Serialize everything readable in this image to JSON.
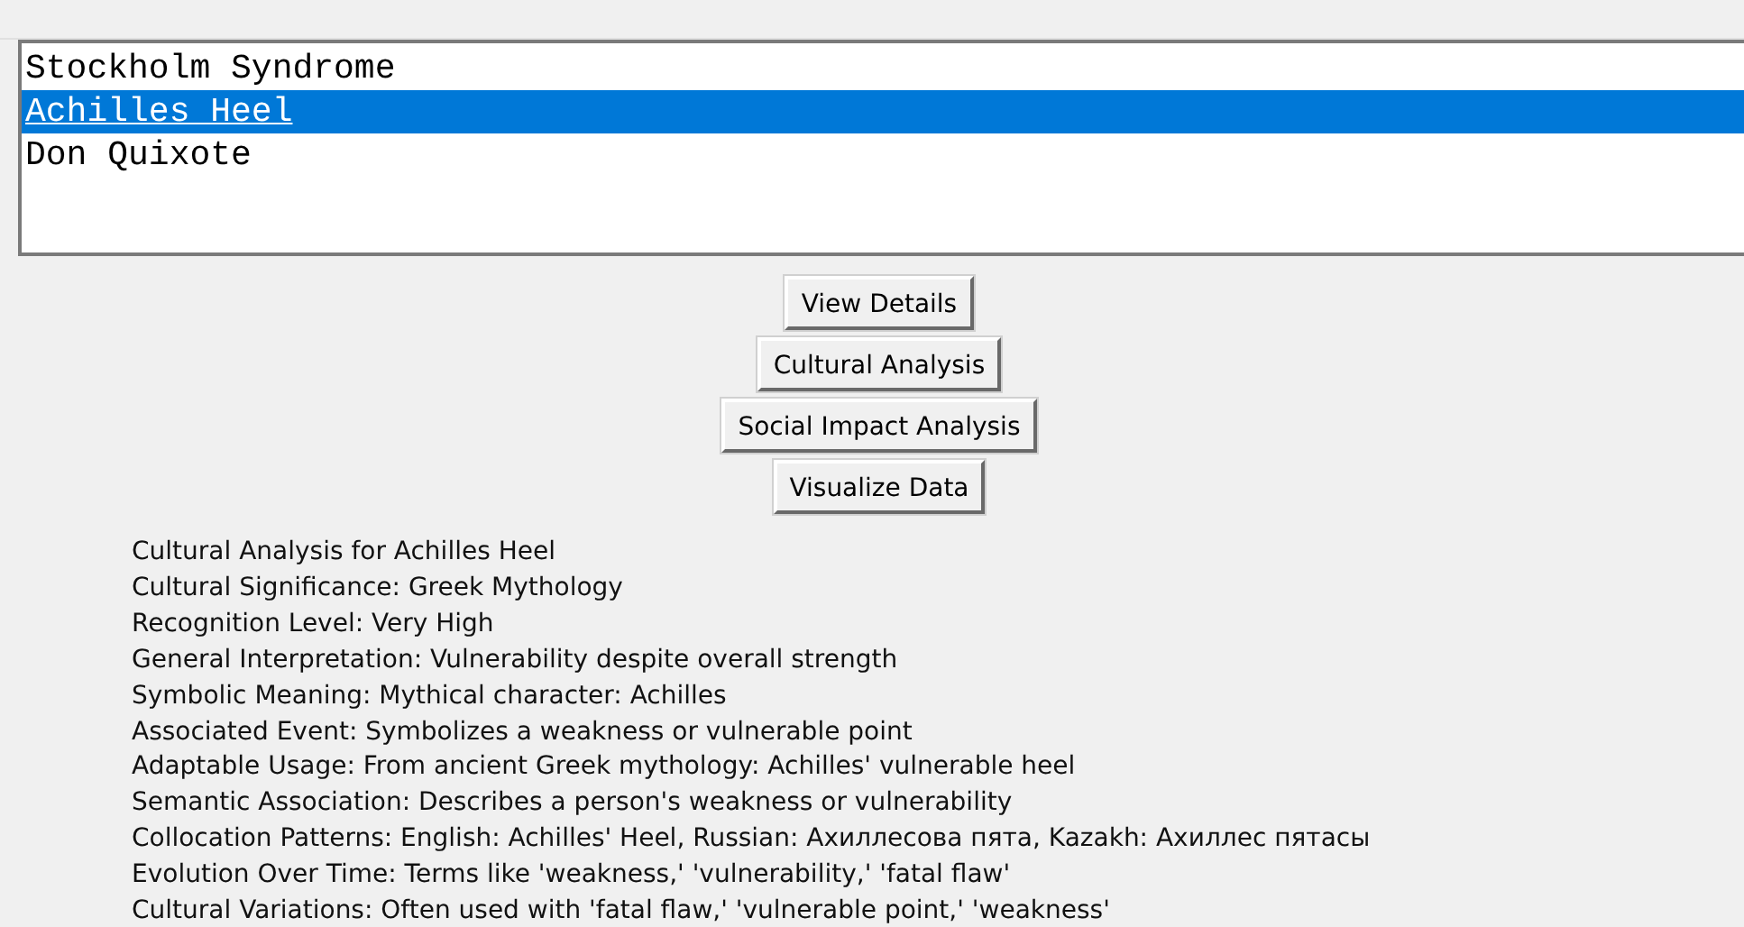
{
  "list": {
    "items": [
      {
        "label": "Stockholm Syndrome",
        "selected": false
      },
      {
        "label": "Achilles Heel",
        "selected": true
      },
      {
        "label": "Don Quixote",
        "selected": false
      }
    ]
  },
  "buttons": [
    "View Details",
    "Cultural Analysis",
    "Social Impact Analysis",
    "Visualize Data"
  ],
  "output_lines": [
    "Cultural Analysis for Achilles Heel",
    "Cultural Significance: Greek Mythology",
    "Recognition Level: Very High",
    "General Interpretation: Vulnerability despite overall strength",
    "Symbolic Meaning: Mythical character: Achilles",
    "Associated Event: Symbolizes a weakness or vulnerable point",
    "Adaptable Usage: From ancient Greek mythology: Achilles' vulnerable heel",
    "Semantic Association: Describes a person's weakness or vulnerability",
    "Collocation Patterns: English: Achilles' Heel, Russian: Ахиллесова пята, Kazakh: Ахиллес пятасы",
    "Evolution Over Time: Terms like 'weakness,' 'vulnerability,' 'fatal flaw'",
    "Cultural Variations: Often used with 'fatal flaw,' 'vulnerable point,' 'weakness'"
  ]
}
